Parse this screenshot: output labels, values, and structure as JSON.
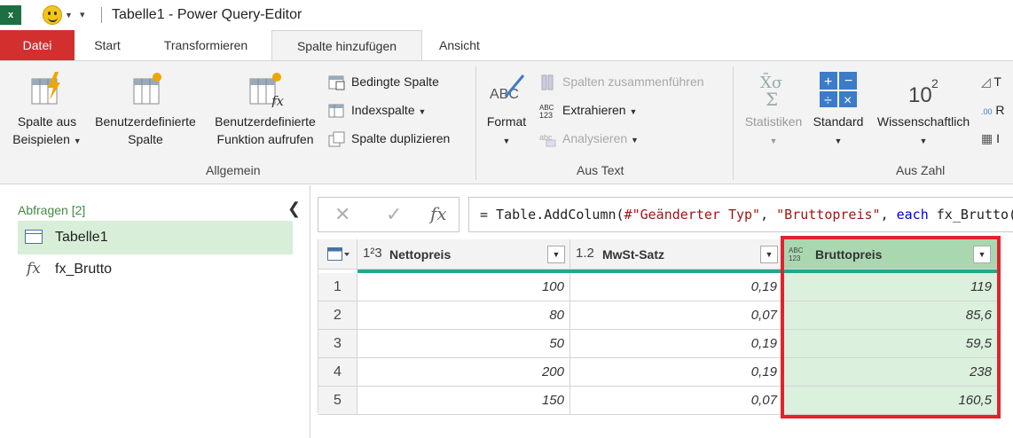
{
  "window": {
    "title": "Tabelle1 - Power Query-Editor",
    "app_icon": "excel-icon",
    "quick_access": {
      "smiley_icon": "smiley-icon",
      "dropdown_icon": "chevron-down-icon",
      "customize_icon": "customize-qat-icon"
    }
  },
  "tabs": [
    {
      "label": "Datei"
    },
    {
      "label": "Start"
    },
    {
      "label": "Transformieren"
    },
    {
      "label": "Spalte hinzufügen",
      "active": true
    },
    {
      "label": "Ansicht"
    }
  ],
  "ribbon": {
    "allgemein": {
      "label": "Allgemein",
      "spalte_aus_beispielen": [
        "Spalte aus",
        "Beispielen"
      ],
      "benutzerdefinierte_spalte": [
        "Benutzerdefinierte",
        "Spalte"
      ],
      "benutzerdefinierte_funktion": [
        "Benutzerdefinierte",
        "Funktion aufrufen"
      ],
      "bedingte_spalte": "Bedingte Spalte",
      "indexspalte": "Indexspalte",
      "spalte_duplizieren": "Spalte duplizieren"
    },
    "aus_text": {
      "label": "Aus Text",
      "format": "Format",
      "spalten_zusammenfuehren": "Spalten zusammenführen",
      "extrahieren": "Extrahieren",
      "analysieren": "Analysieren"
    },
    "aus_zahl": {
      "label": "Aus Zahl",
      "statistiken": "Statistiken",
      "standard": "Standard",
      "wissenschaftlich": "Wissenschaftlich",
      "partial_1": "T",
      "partial_2": "R",
      "partial_3": "I"
    }
  },
  "queries": {
    "header": "Abfragen [2]",
    "items": [
      {
        "label": "Tabelle1",
        "icon": "table-icon",
        "selected": true
      },
      {
        "label": "fx_Brutto",
        "icon": "function-icon"
      }
    ]
  },
  "formula_bar": {
    "prefix": "= Table.AddColumn(",
    "arg1": "#\"Geänderter Typ\"",
    "sep1": ", ",
    "arg2": "\"Bruttopreis\"",
    "sep2": ", ",
    "kw": "each",
    "rest": " fx_Brutto("
  },
  "grid": {
    "columns": [
      {
        "type": "1²3",
        "name": "Nettopreis"
      },
      {
        "type": "1.2",
        "name": "MwSt-Satz"
      },
      {
        "type": "ABC 123",
        "name": "Bruttopreis",
        "selected": true
      }
    ],
    "rows": [
      {
        "n": "1",
        "netto": "100",
        "mwst": "0,19",
        "brutto": "119"
      },
      {
        "n": "2",
        "netto": "80",
        "mwst": "0,07",
        "brutto": "85,6"
      },
      {
        "n": "3",
        "netto": "50",
        "mwst": "0,19",
        "brutto": "59,5"
      },
      {
        "n": "4",
        "netto": "200",
        "mwst": "0,19",
        "brutto": "238"
      },
      {
        "n": "5",
        "netto": "150",
        "mwst": "0,07",
        "brutto": "160,5"
      }
    ]
  },
  "colors": {
    "accent_red": "#d32f2f",
    "highlight_red": "#e0242e",
    "selected_green": "#a9d8b0",
    "quality_bar": "#21a88e"
  }
}
